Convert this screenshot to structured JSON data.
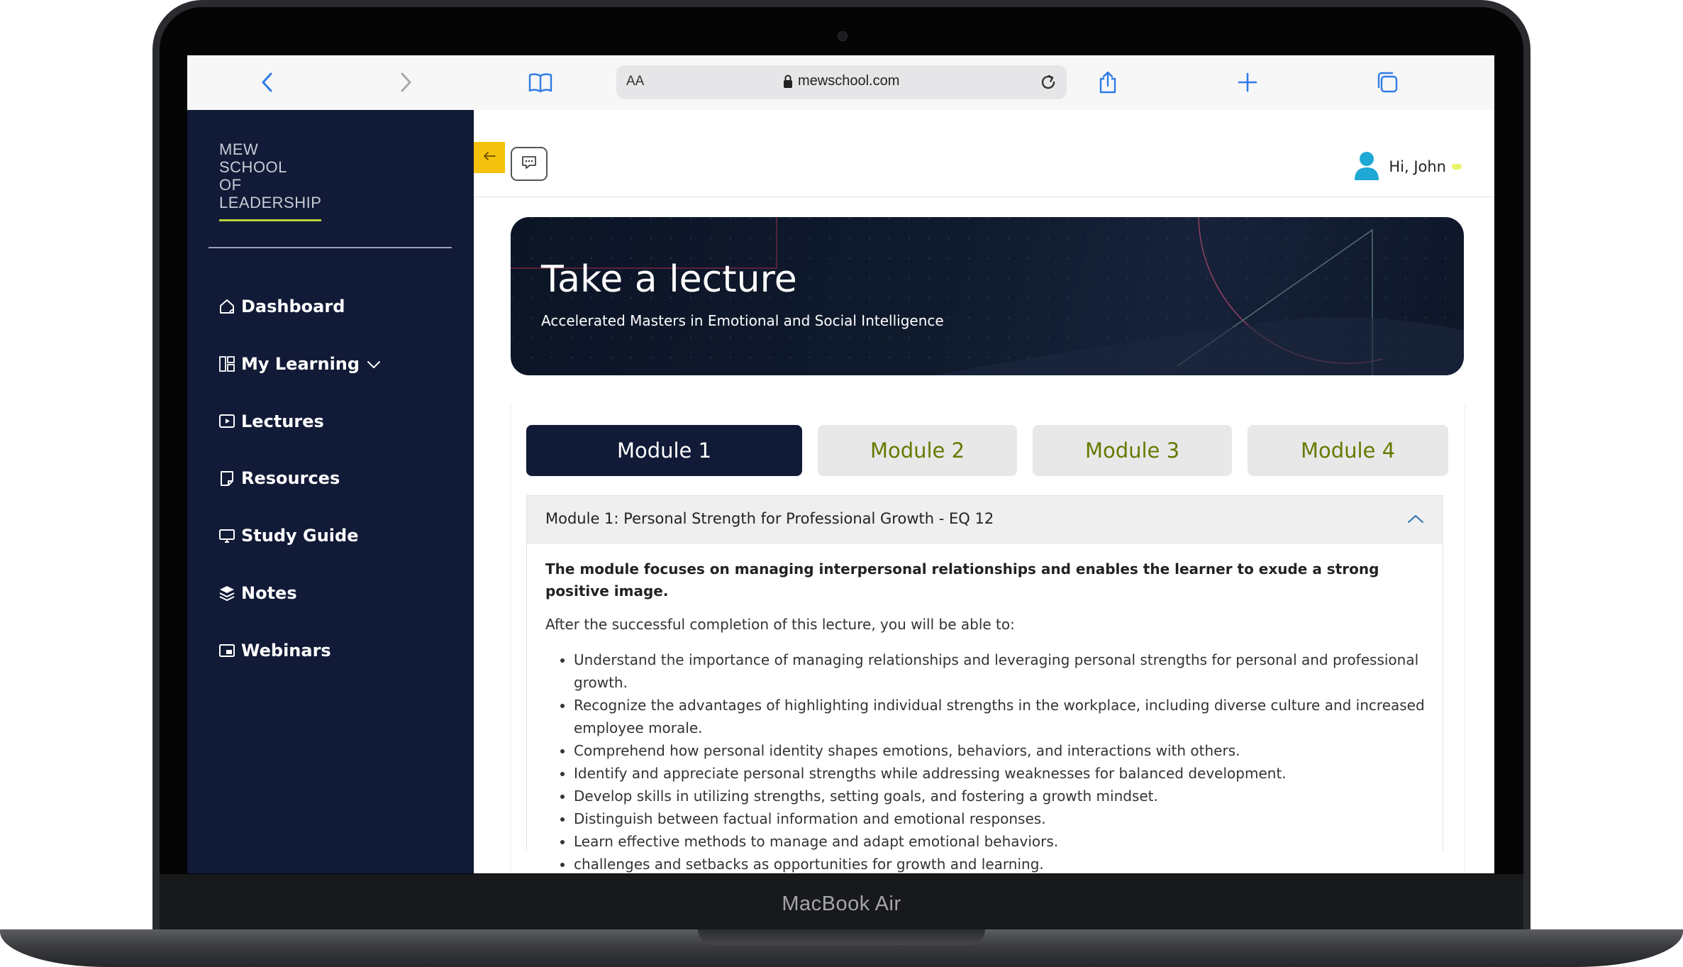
{
  "device": {
    "label": "MacBook Air"
  },
  "browser": {
    "text_size_label": "AA",
    "url": "mewschool.com"
  },
  "sidebar": {
    "logo_lines": [
      "MEW",
      "SCHOOL",
      "OF",
      "LEADERSHIP"
    ],
    "items": [
      {
        "label": "Dashboard",
        "icon": "home-icon"
      },
      {
        "label": "My Learning",
        "icon": "layout-icon",
        "has_dropdown": true
      },
      {
        "label": "Lectures",
        "icon": "play-icon"
      },
      {
        "label": "Resources",
        "icon": "document-icon"
      },
      {
        "label": "Study Guide",
        "icon": "monitor-icon"
      },
      {
        "label": "Notes",
        "icon": "layers-icon"
      },
      {
        "label": "Webinars",
        "icon": "picture-in-picture-icon"
      }
    ]
  },
  "header": {
    "greeting": "Hi, John"
  },
  "hero": {
    "title": "Take a lecture",
    "subtitle": "Accelerated Masters in Emotional and Social Intelligence"
  },
  "tabs": [
    {
      "label": "Module 1",
      "active": true
    },
    {
      "label": "Module 2",
      "active": false
    },
    {
      "label": "Module 3",
      "active": false
    },
    {
      "label": "Module 4",
      "active": false
    }
  ],
  "module": {
    "title": "Module 1: Personal Strength for Professional Growth - EQ 12",
    "lead": "The module focuses on managing interpersonal relationships and enables the learner to exude a strong positive image.",
    "intro": "After the successful completion of this lecture, you will be able to:",
    "outcomes": [
      "Understand the importance of managing relationships and leveraging personal strengths for personal and professional growth.",
      "Recognize the advantages of highlighting individual strengths in the workplace, including diverse culture and increased employee morale.",
      "Comprehend how personal identity shapes emotions, behaviors, and interactions with others.",
      "Identify and appreciate personal strengths while addressing weaknesses for balanced development.",
      "Develop skills in utilizing strengths, setting goals, and fostering a growth mindset.",
      "Distinguish between factual information and emotional responses.",
      "Learn effective methods to manage and adapt emotional behaviors.",
      "challenges and setbacks as opportunities for growth and learning."
    ]
  },
  "colors": {
    "sidebar_bg": "#111a36",
    "accent_yellow": "#f4c20d",
    "tab_inactive_text": "#667a00",
    "logo_underline": "#b8d23c",
    "browser_icon": "#2f7be6",
    "avatar": "#1fa8d6"
  }
}
